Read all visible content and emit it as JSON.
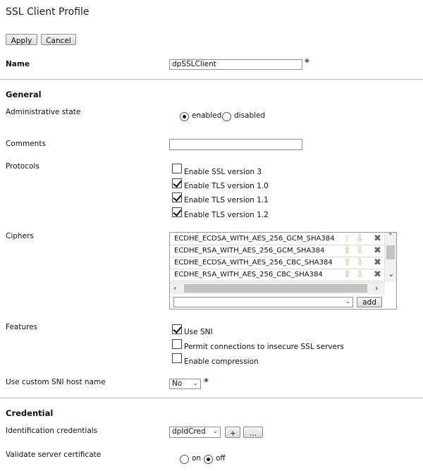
{
  "page": {
    "title": "SSL Client Profile"
  },
  "toolbar": {
    "apply_label": "Apply",
    "cancel_label": "Cancel"
  },
  "required_marker": "*",
  "name": {
    "label": "Name",
    "value": "dpSSLClient"
  },
  "general": {
    "section_title": "General",
    "admin_state": {
      "label": "Administrative state",
      "options": [
        "enabled",
        "disabled"
      ],
      "selected": "enabled"
    },
    "comments": {
      "label": "Comments",
      "value": ""
    },
    "protocols": {
      "label": "Protocols",
      "items": [
        {
          "label": "Enable SSL version 3",
          "checked": false
        },
        {
          "label": "Enable TLS version 1.0",
          "checked": true
        },
        {
          "label": "Enable TLS version 1.1",
          "checked": true
        },
        {
          "label": "Enable TLS version 1.2",
          "checked": true
        }
      ]
    },
    "ciphers": {
      "label": "Ciphers",
      "items": [
        "ECDHE_ECDSA_WITH_AES_256_GCM_SHA384",
        "ECDHE_RSA_WITH_AES_256_GCM_SHA384",
        "ECDHE_ECDSA_WITH_AES_256_CBC_SHA384",
        "ECDHE_RSA_WITH_AES_256_CBC_SHA384"
      ],
      "add_value": "",
      "add_label": "add"
    },
    "features": {
      "label": "Features",
      "items": [
        {
          "label": "Use SNI",
          "checked": true
        },
        {
          "label": "Permit connections to insecure SSL servers",
          "checked": false
        },
        {
          "label": "Enable compression",
          "checked": false
        }
      ]
    },
    "custom_sni": {
      "label": "Use custom SNI host name",
      "value": "No"
    }
  },
  "credential": {
    "section_title": "Credential",
    "identification": {
      "label": "Identification credentials",
      "value": "dpIdCred",
      "add_label": "+",
      "edit_label": "..."
    },
    "validate": {
      "label": "Validate server certificate",
      "options": [
        "on",
        "off"
      ],
      "selected": "off"
    }
  },
  "colors": {
    "arrow": "#f3b21b",
    "required": "#1d3a94",
    "divider": "#b9b9b9"
  },
  "icons": {
    "move_up": "arrow-up-icon",
    "move_down": "arrow-down-icon",
    "delete": "delete-icon"
  }
}
